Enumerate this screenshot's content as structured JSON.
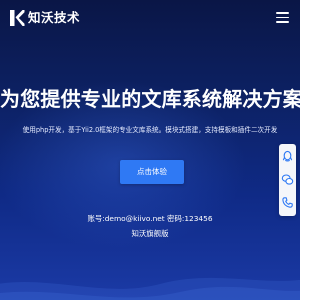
{
  "header": {
    "brand_name": "知沃技术",
    "logo_icon": "k-logo-icon",
    "menu_icon": "hamburger-menu-icon"
  },
  "hero": {
    "title": "为您提供专业的文库系统解决方案",
    "subtitle": "使用php开发，基于Yii2.0框架的专业文库系统。模块式搭建，支持模板和插件二次开发",
    "cta_label": "点击体验",
    "demo_account": "账号:demo@kiivo.net   密码:123456",
    "edition": "知沃旗舰版"
  },
  "side_tools": [
    {
      "icon": "qq-icon"
    },
    {
      "icon": "wechat-icon"
    },
    {
      "icon": "phone-icon"
    }
  ],
  "colors": {
    "background_top": "#0a1646",
    "background_bottom": "#1b3aa6",
    "accent": "#2f79f4",
    "tool_icon": "#2f79f4"
  }
}
